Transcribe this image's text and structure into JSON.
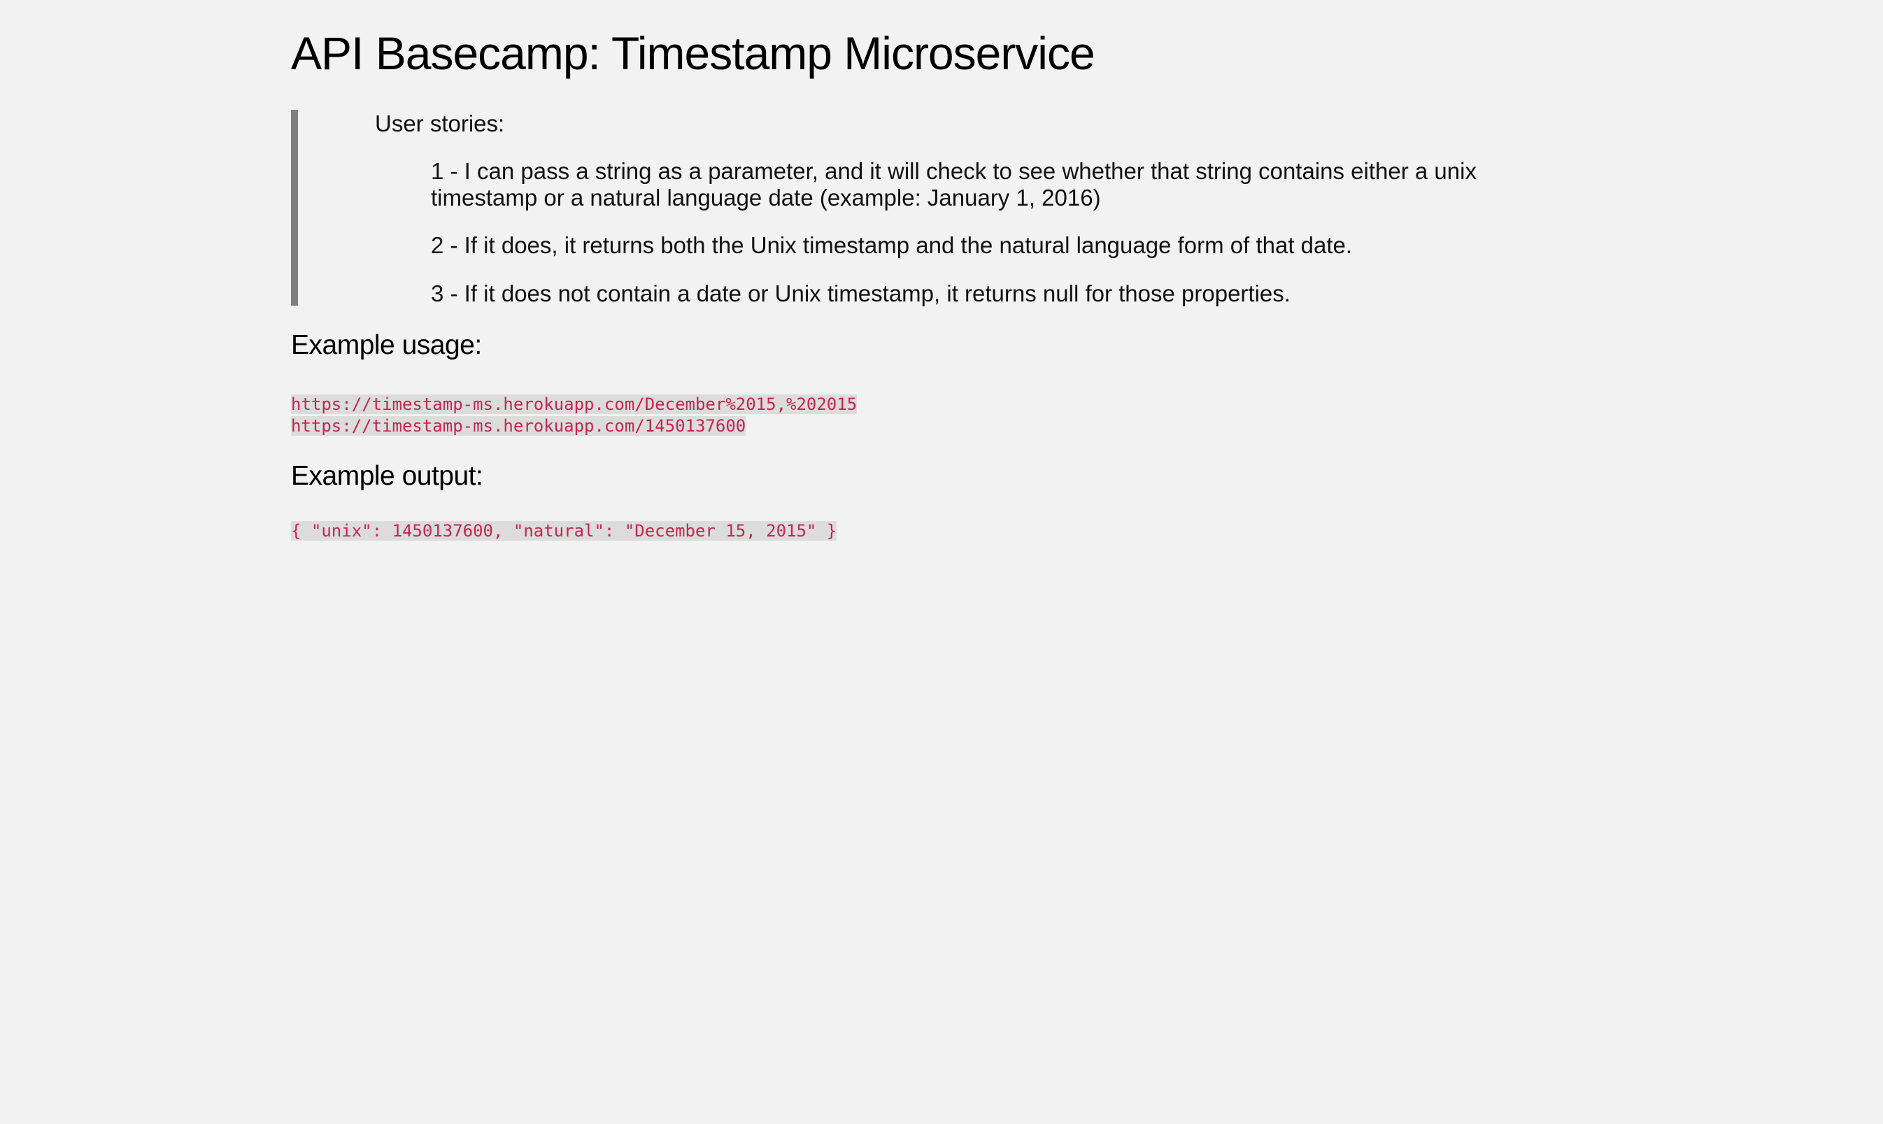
{
  "page": {
    "title": "API Basecamp: Timestamp Microservice"
  },
  "user_stories": {
    "intro": "User stories:",
    "items": [
      "1 - I can pass a string as a parameter, and it will check to see whether that string contains either a unix timestamp or a natural language date (example: January 1, 2016)",
      "2 - If it does, it returns both the Unix timestamp and the natural language form of that date.",
      "3 - If it does not contain a date or Unix timestamp, it returns null for those properties."
    ]
  },
  "example_usage": {
    "heading": "Example usage:",
    "lines": [
      "https://timestamp-ms.herokuapp.com/December%2015,%202015",
      "https://timestamp-ms.herokuapp.com/1450137600"
    ]
  },
  "example_output": {
    "heading": "Example output:",
    "code": "{ \"unix\": 1450137600, \"natural\": \"December 15, 2015\" }"
  },
  "colors": {
    "background": "#f2f2f2",
    "blockquote_border": "#808080",
    "code_text": "#c7254e",
    "code_background": "#dcdcdc"
  }
}
